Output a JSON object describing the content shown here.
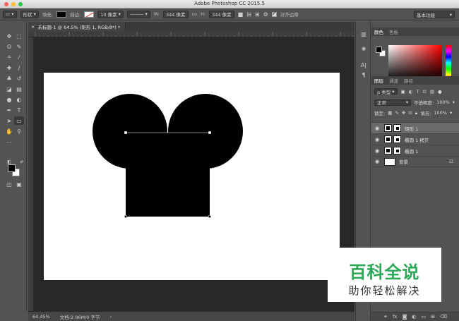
{
  "window": {
    "title": "Adobe Photoshop CC 2015.5"
  },
  "options_bar": {
    "tool_mode": "形状",
    "fill_label": "填充:",
    "stroke_label": "描边:",
    "stroke_width": "10 像素",
    "width_label": "W:",
    "width_value": "344 像素",
    "link_icon": "co",
    "height_label": "H:",
    "height_value": "344 像素",
    "align_edges_label": "对齐边缘",
    "workspace": "基本功能"
  },
  "document": {
    "tab_title": "未标题-1 @ 64.5% (矩形 1, RGB/8*) *"
  },
  "status": {
    "zoom": "64.45%",
    "doc_size": "文档:2.96M/0 字节"
  },
  "color_panel": {
    "tabs": [
      "颜色",
      "色板"
    ]
  },
  "layers_panel": {
    "tabs": [
      "图层",
      "通道",
      "路径"
    ],
    "filter_kind": "ρ 类型",
    "blend_mode": "正常",
    "opacity_label": "不透明度:",
    "opacity_value": "100%",
    "lock_label": "锁定:",
    "fill_label": "填充:",
    "fill_value": "100%",
    "layers": [
      {
        "name": "矩形 1",
        "selected": true
      },
      {
        "name": "椭圆 1 拷贝",
        "selected": false
      },
      {
        "name": "椭圆 1",
        "selected": false
      },
      {
        "name": "背景",
        "selected": false,
        "locked": true
      }
    ],
    "footer_icons": [
      "link-icon",
      "fx-icon",
      "mask-icon",
      "adjustment-icon",
      "folder-icon",
      "new-layer-icon",
      "trash-icon"
    ]
  },
  "watermark": {
    "title": "百科全说",
    "subtitle": "助你轻松解决"
  },
  "colors": {
    "ui_bg": "#535353",
    "pasteboard": "#282828",
    "watermark_green": "#2aa855"
  }
}
